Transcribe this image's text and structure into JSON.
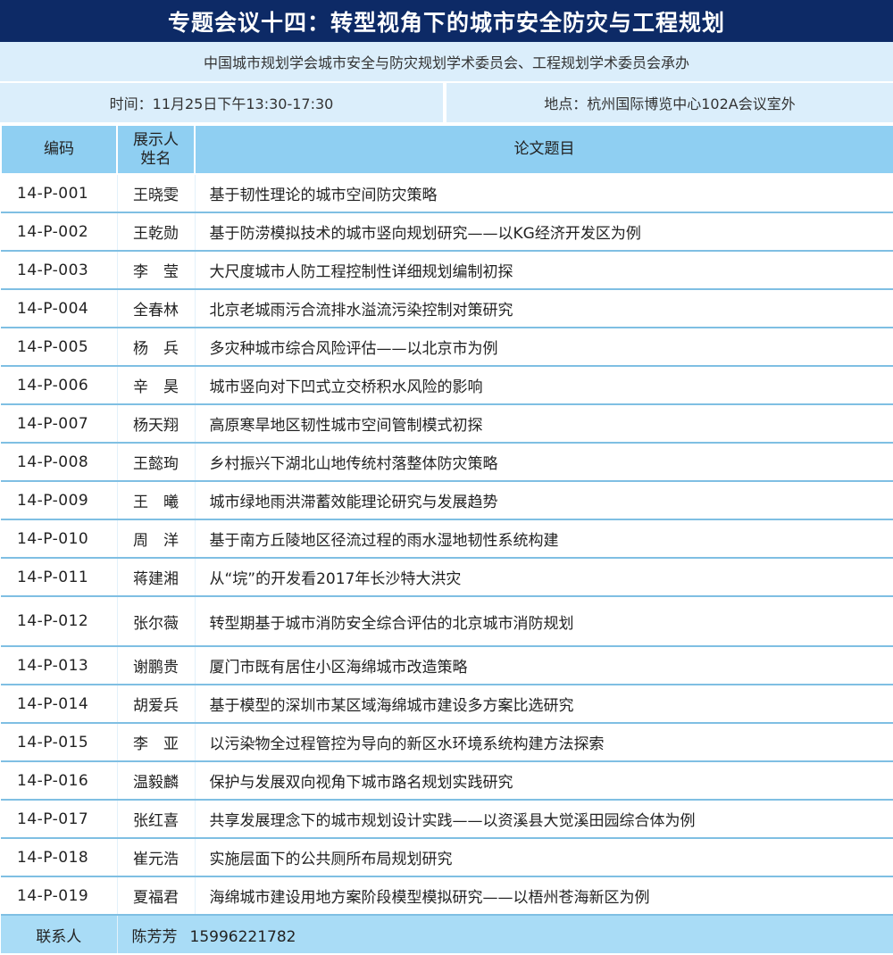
{
  "header": {
    "title": "专题会议十四：转型视角下的城市安全防灾与工程规划",
    "organizer": "中国城市规划学会城市安全与防灾规划学术委员会、工程规划学术委员会承办",
    "time": "时间：11月25日下午13:30-17:30",
    "place": "地点：杭州国际博览中心102A会议室外"
  },
  "table": {
    "columns": [
      "编码",
      "展示人姓名",
      "论文题目"
    ],
    "rows": [
      {
        "code": "14-P-001",
        "name": "王晓雯",
        "title": "基于韧性理论的城市空间防灾策略"
      },
      {
        "code": "14-P-002",
        "name": "王乾勋",
        "title": "基于防涝模拟技术的城市竖向规划研究——以KG经济开发区为例"
      },
      {
        "code": "14-P-003",
        "name": "李　莹",
        "title": "大尺度城市人防工程控制性详细规划编制初探"
      },
      {
        "code": "14-P-004",
        "name": "全春林",
        "title": "北京老城雨污合流排水溢流污染控制对策研究"
      },
      {
        "code": "14-P-005",
        "name": "杨　兵",
        "title": "多灾种城市综合风险评估——以北京市为例"
      },
      {
        "code": "14-P-006",
        "name": "辛　昊",
        "title": "城市竖向对下凹式立交桥积水风险的影响"
      },
      {
        "code": "14-P-007",
        "name": "杨天翔",
        "title": "高原寒旱地区韧性城市空间管制模式初探"
      },
      {
        "code": "14-P-008",
        "name": "王懿珣",
        "title": "乡村振兴下湖北山地传统村落整体防灾策略"
      },
      {
        "code": "14-P-009",
        "name": "王　曦",
        "title": "城市绿地雨洪滞蓄效能理论研究与发展趋势"
      },
      {
        "code": "14-P-010",
        "name": "周　洋",
        "title": "基于南方丘陵地区径流过程的雨水湿地韧性系统构建"
      },
      {
        "code": "14-P-011",
        "name": "蒋建湘",
        "title": "从“垸”的开发看2017年长沙特大洪灾"
      },
      {
        "code": "14-P-012",
        "name": "张尔薇",
        "title": "转型期基于城市消防安全综合评估的北京城市消防规划"
      },
      {
        "code": "14-P-013",
        "name": "谢鹏贵",
        "title": "厦门市既有居住小区海绵城市改造策略"
      },
      {
        "code": "14-P-014",
        "name": "胡爱兵",
        "title": "基于模型的深圳市某区域海绵城市建设多方案比选研究"
      },
      {
        "code": "14-P-015",
        "name": "李　亚",
        "title": "以污染物全过程管控为导向的新区水环境系统构建方法探索"
      },
      {
        "code": "14-P-016",
        "name": "温毅麟",
        "title": "保护与发展双向视角下城市路名规划实践研究"
      },
      {
        "code": "14-P-017",
        "name": "张红喜",
        "title": "共享发展理念下的城市规划设计实践——以资溪县大觉溪田园综合体为例"
      },
      {
        "code": "14-P-018",
        "name": "崔元浩",
        "title": "实施层面下的公共厕所布局规划研究"
      },
      {
        "code": "14-P-019",
        "name": "夏福君",
        "title": "海绵城市建设用地方案阶段模型模拟研究——以梧州苍海新区为例"
      }
    ]
  },
  "contact": {
    "label": "联系人",
    "name": "陈芳芳",
    "phone": "15996221782"
  },
  "colors": {
    "title_bg": "#0d2a66",
    "header_row_bg": "#8fcff2",
    "info_bg": "#dbeefb",
    "contact_bg": "#a9dcf6",
    "row_divider": "#7fbfe3"
  }
}
